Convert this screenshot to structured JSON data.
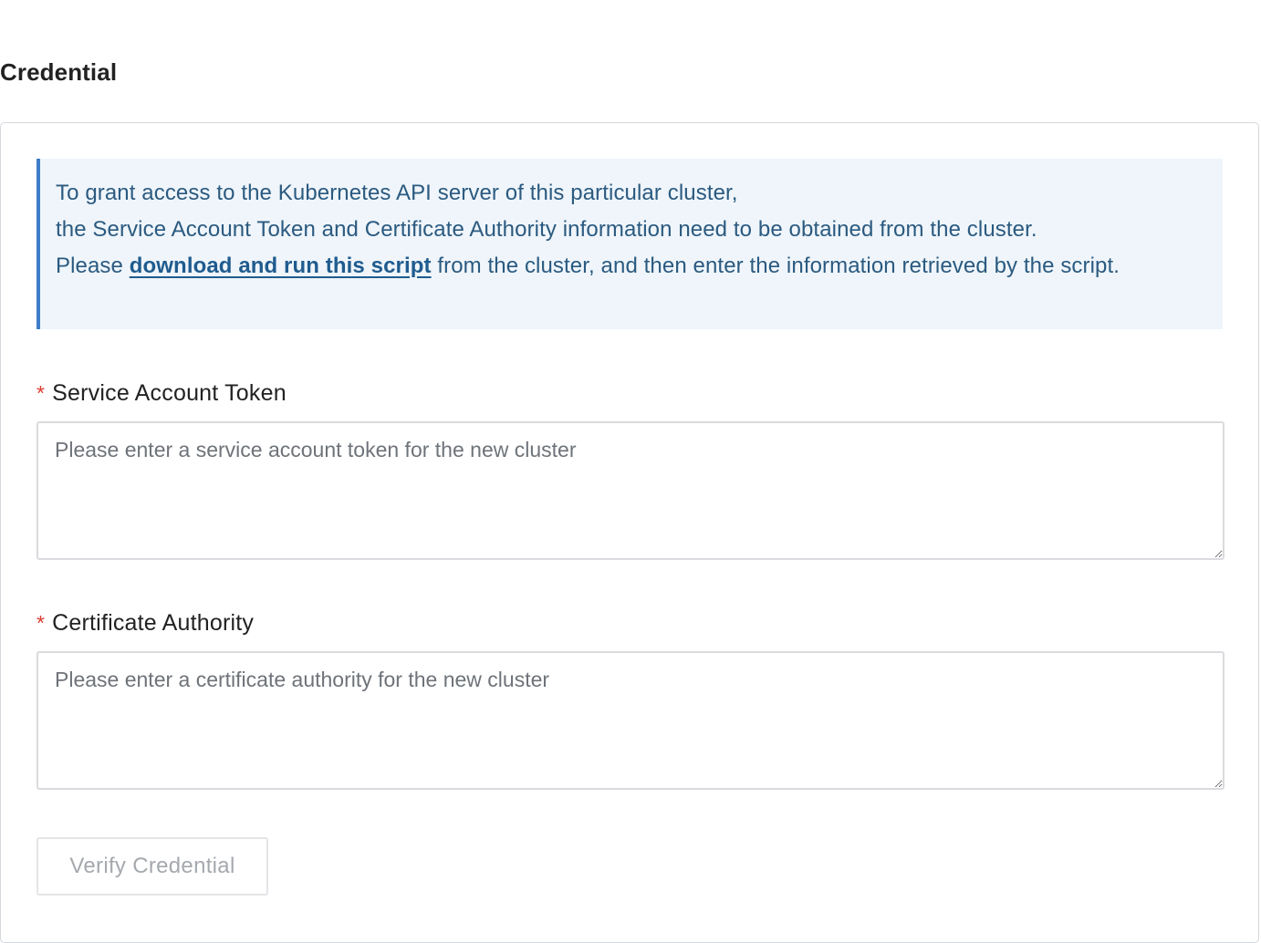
{
  "section": {
    "title": "Credential"
  },
  "info": {
    "line1": "To grant access to the Kubernetes API server of this particular cluster,",
    "line2": "the Service Account Token and Certificate Authority information need to be obtained from the cluster.",
    "line3_prefix": "Please ",
    "link_text": "download and run this script",
    "line3_suffix": " from the cluster, and then enter the information retrieved by the script."
  },
  "token_field": {
    "required_mark": "*",
    "label": "Service Account Token",
    "value": "",
    "placeholder": "Please enter a service account token for the new cluster"
  },
  "ca_field": {
    "required_mark": "*",
    "label": "Certificate Authority",
    "value": "",
    "placeholder": "Please enter a certificate authority for the new cluster"
  },
  "verify_button": {
    "label": "Verify Credential",
    "state": "disabled"
  }
}
